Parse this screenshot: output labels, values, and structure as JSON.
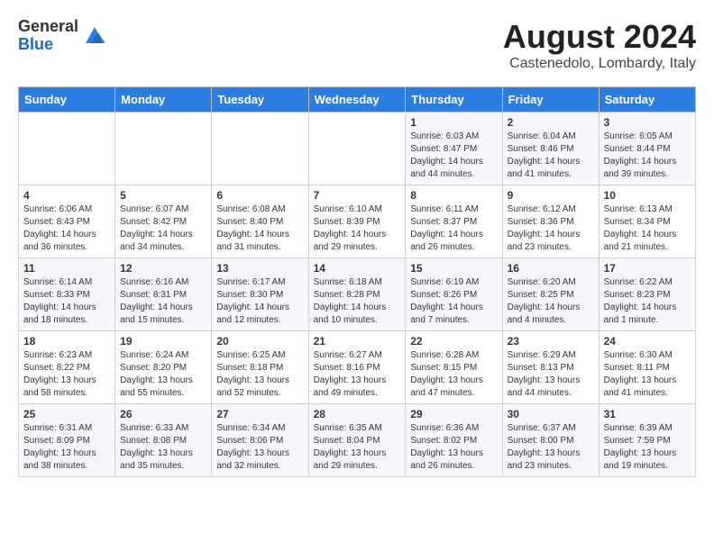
{
  "header": {
    "logo_line1": "General",
    "logo_line2": "Blue",
    "title": "August 2024",
    "subtitle": "Castenedolo, Lombardy, Italy"
  },
  "weekdays": [
    "Sunday",
    "Monday",
    "Tuesday",
    "Wednesday",
    "Thursday",
    "Friday",
    "Saturday"
  ],
  "weeks": [
    [
      {
        "day": "",
        "info": ""
      },
      {
        "day": "",
        "info": ""
      },
      {
        "day": "",
        "info": ""
      },
      {
        "day": "",
        "info": ""
      },
      {
        "day": "1",
        "info": "Sunrise: 6:03 AM\nSunset: 8:47 PM\nDaylight: 14 hours\nand 44 minutes."
      },
      {
        "day": "2",
        "info": "Sunrise: 6:04 AM\nSunset: 8:46 PM\nDaylight: 14 hours\nand 41 minutes."
      },
      {
        "day": "3",
        "info": "Sunrise: 6:05 AM\nSunset: 8:44 PM\nDaylight: 14 hours\nand 39 minutes."
      }
    ],
    [
      {
        "day": "4",
        "info": "Sunrise: 6:06 AM\nSunset: 8:43 PM\nDaylight: 14 hours\nand 36 minutes."
      },
      {
        "day": "5",
        "info": "Sunrise: 6:07 AM\nSunset: 8:42 PM\nDaylight: 14 hours\nand 34 minutes."
      },
      {
        "day": "6",
        "info": "Sunrise: 6:08 AM\nSunset: 8:40 PM\nDaylight: 14 hours\nand 31 minutes."
      },
      {
        "day": "7",
        "info": "Sunrise: 6:10 AM\nSunset: 8:39 PM\nDaylight: 14 hours\nand 29 minutes."
      },
      {
        "day": "8",
        "info": "Sunrise: 6:11 AM\nSunset: 8:37 PM\nDaylight: 14 hours\nand 26 minutes."
      },
      {
        "day": "9",
        "info": "Sunrise: 6:12 AM\nSunset: 8:36 PM\nDaylight: 14 hours\nand 23 minutes."
      },
      {
        "day": "10",
        "info": "Sunrise: 6:13 AM\nSunset: 8:34 PM\nDaylight: 14 hours\nand 21 minutes."
      }
    ],
    [
      {
        "day": "11",
        "info": "Sunrise: 6:14 AM\nSunset: 8:33 PM\nDaylight: 14 hours\nand 18 minutes."
      },
      {
        "day": "12",
        "info": "Sunrise: 6:16 AM\nSunset: 8:31 PM\nDaylight: 14 hours\nand 15 minutes."
      },
      {
        "day": "13",
        "info": "Sunrise: 6:17 AM\nSunset: 8:30 PM\nDaylight: 14 hours\nand 12 minutes."
      },
      {
        "day": "14",
        "info": "Sunrise: 6:18 AM\nSunset: 8:28 PM\nDaylight: 14 hours\nand 10 minutes."
      },
      {
        "day": "15",
        "info": "Sunrise: 6:19 AM\nSunset: 8:26 PM\nDaylight: 14 hours\nand 7 minutes."
      },
      {
        "day": "16",
        "info": "Sunrise: 6:20 AM\nSunset: 8:25 PM\nDaylight: 14 hours\nand 4 minutes."
      },
      {
        "day": "17",
        "info": "Sunrise: 6:22 AM\nSunset: 8:23 PM\nDaylight: 14 hours\nand 1 minute."
      }
    ],
    [
      {
        "day": "18",
        "info": "Sunrise: 6:23 AM\nSunset: 8:22 PM\nDaylight: 13 hours\nand 58 minutes."
      },
      {
        "day": "19",
        "info": "Sunrise: 6:24 AM\nSunset: 8:20 PM\nDaylight: 13 hours\nand 55 minutes."
      },
      {
        "day": "20",
        "info": "Sunrise: 6:25 AM\nSunset: 8:18 PM\nDaylight: 13 hours\nand 52 minutes."
      },
      {
        "day": "21",
        "info": "Sunrise: 6:27 AM\nSunset: 8:16 PM\nDaylight: 13 hours\nand 49 minutes."
      },
      {
        "day": "22",
        "info": "Sunrise: 6:28 AM\nSunset: 8:15 PM\nDaylight: 13 hours\nand 47 minutes."
      },
      {
        "day": "23",
        "info": "Sunrise: 6:29 AM\nSunset: 8:13 PM\nDaylight: 13 hours\nand 44 minutes."
      },
      {
        "day": "24",
        "info": "Sunrise: 6:30 AM\nSunset: 8:11 PM\nDaylight: 13 hours\nand 41 minutes."
      }
    ],
    [
      {
        "day": "25",
        "info": "Sunrise: 6:31 AM\nSunset: 8:09 PM\nDaylight: 13 hours\nand 38 minutes."
      },
      {
        "day": "26",
        "info": "Sunrise: 6:33 AM\nSunset: 8:08 PM\nDaylight: 13 hours\nand 35 minutes."
      },
      {
        "day": "27",
        "info": "Sunrise: 6:34 AM\nSunset: 8:06 PM\nDaylight: 13 hours\nand 32 minutes."
      },
      {
        "day": "28",
        "info": "Sunrise: 6:35 AM\nSunset: 8:04 PM\nDaylight: 13 hours\nand 29 minutes."
      },
      {
        "day": "29",
        "info": "Sunrise: 6:36 AM\nSunset: 8:02 PM\nDaylight: 13 hours\nand 26 minutes."
      },
      {
        "day": "30",
        "info": "Sunrise: 6:37 AM\nSunset: 8:00 PM\nDaylight: 13 hours\nand 23 minutes."
      },
      {
        "day": "31",
        "info": "Sunrise: 6:39 AM\nSunset: 7:59 PM\nDaylight: 13 hours\nand 19 minutes."
      }
    ]
  ]
}
